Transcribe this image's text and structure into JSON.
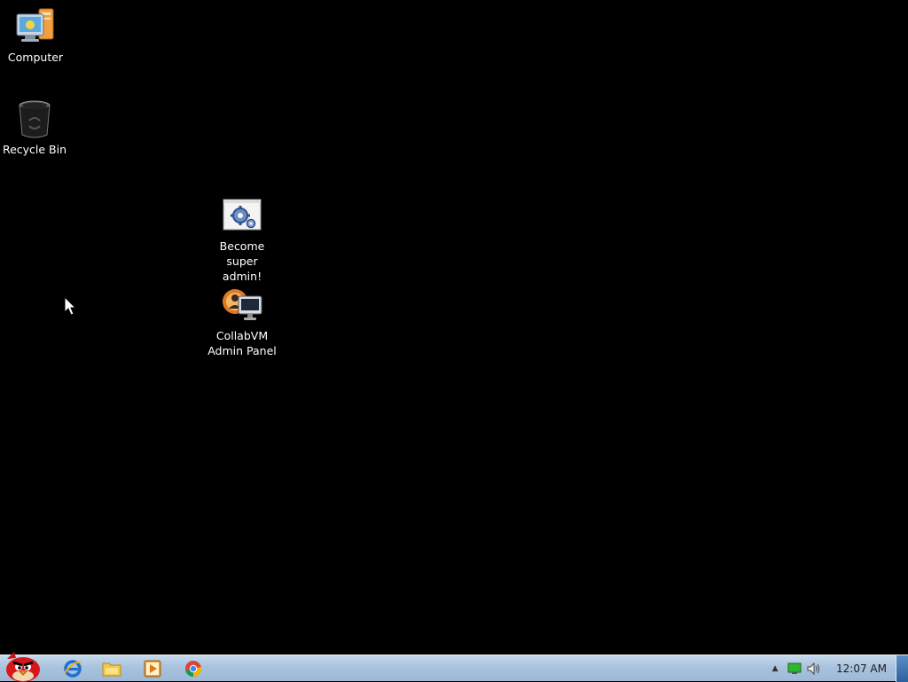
{
  "desktop": {
    "icons": [
      {
        "label": "Computer",
        "icon": "computer-icon"
      },
      {
        "label": "Recycle Bin",
        "icon": "recycle-bin-icon"
      },
      {
        "label": "Become\nsuper\nadmin!",
        "icon": "settings-gear-icon"
      },
      {
        "label": "CollabVM\nAdmin Panel",
        "icon": "admin-panel-icon"
      }
    ]
  },
  "taskbar": {
    "start_icon": "angry-bird-start-icon",
    "pinned": [
      {
        "name": "Internet Explorer",
        "icon": "ie-icon"
      },
      {
        "name": "Windows Explorer",
        "icon": "folder-icon"
      },
      {
        "name": "Windows Media Player",
        "icon": "media-player-icon"
      },
      {
        "name": "Google Chrome",
        "icon": "chrome-icon"
      }
    ],
    "tray": {
      "overflow_glyph": "▲",
      "clock": "12:07 AM"
    }
  },
  "colors": {
    "desktop_background": "#000000",
    "taskbar": "#a9c3de",
    "icon_label": "#ffffff"
  }
}
